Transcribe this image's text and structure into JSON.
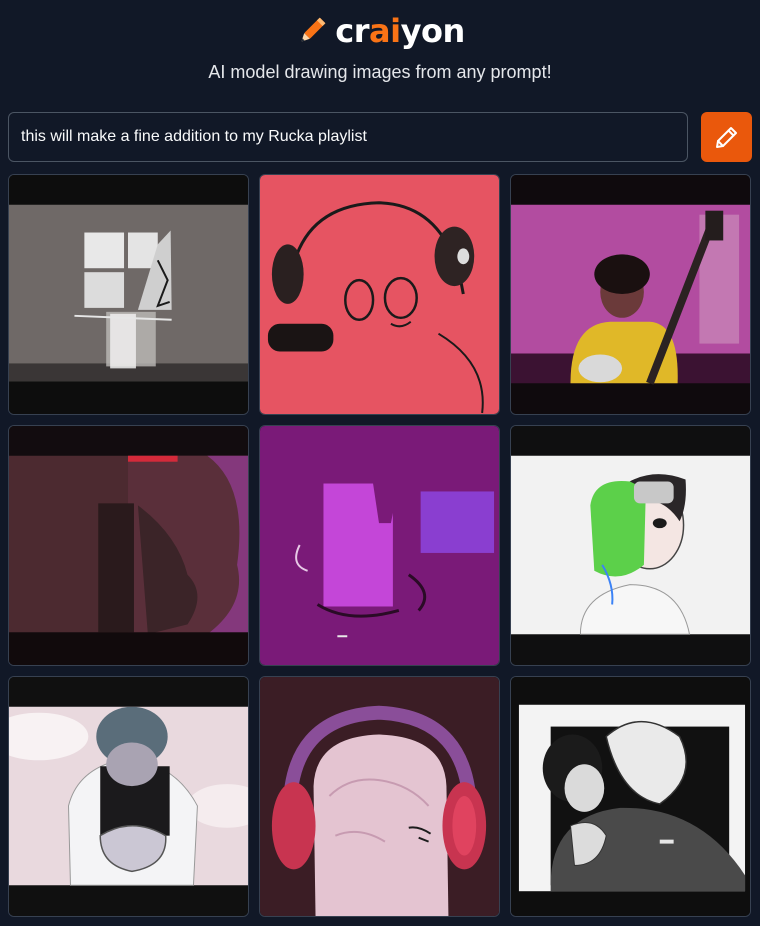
{
  "header": {
    "logo_prefix": "cr",
    "logo_accent": "ai",
    "logo_suffix": "yon",
    "tagline": "AI model drawing images from any prompt!"
  },
  "prompt": {
    "value": "this will make a fine addition to my Rucka playlist"
  },
  "draw_button": {
    "icon": "pencil-icon"
  },
  "colors": {
    "background": "#111827",
    "accent": "#f97316",
    "button": "#ea580c",
    "border": "#4b5563"
  },
  "results": {
    "images": [
      {
        "index": 1,
        "subject": "grey wall sculpture"
      },
      {
        "index": 2,
        "subject": "pink face with headphones"
      },
      {
        "index": 3,
        "subject": "person with guitar on magenta"
      },
      {
        "index": 4,
        "subject": "dark maroon room"
      },
      {
        "index": 5,
        "subject": "purple abstract cup"
      },
      {
        "index": 6,
        "subject": "anime face with green headphones"
      },
      {
        "index": 7,
        "subject": "person hunched over"
      },
      {
        "index": 8,
        "subject": "head with red headphones"
      },
      {
        "index": 9,
        "subject": "black and white sketch of two people"
      }
    ]
  }
}
